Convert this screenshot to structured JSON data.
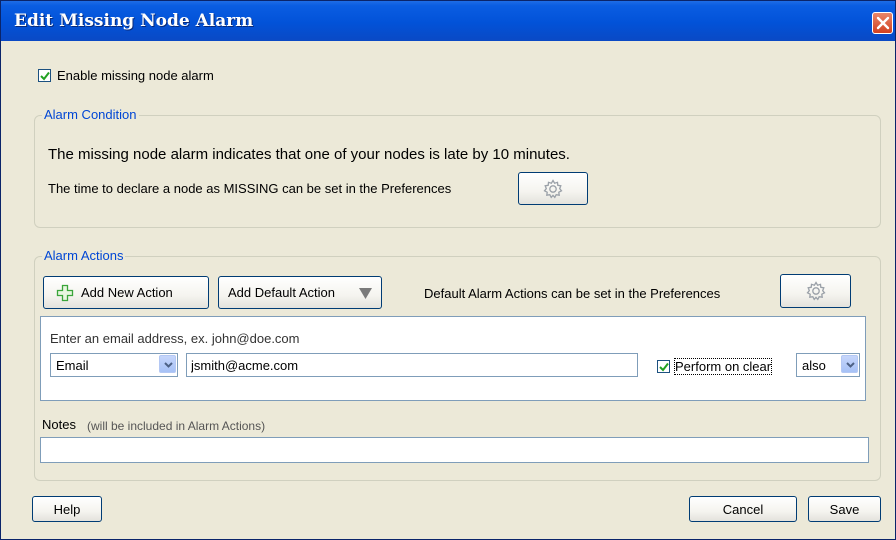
{
  "window": {
    "title": "Edit Missing Node Alarm"
  },
  "enable": {
    "label": "Enable missing node alarm",
    "checked": true
  },
  "condition": {
    "title": "Alarm Condition",
    "description": "The missing node alarm indicates that one of your nodes is late by 10 minutes.",
    "preferences_text": "The time to declare a node as MISSING can be set in the Preferences",
    "preferences_icon": "gear-icon"
  },
  "actions": {
    "title": "Alarm Actions",
    "add_new_label": "Add New Action",
    "add_new_icon": "plus-icon",
    "add_default_label": "Add Default Action",
    "default_text": "Default Alarm Actions can be set in the Preferences",
    "preferences_icon": "gear-icon",
    "row": {
      "hint": "Enter an email address, ex. john@doe.com",
      "type_value": "Email",
      "email_value": "jsmith@acme.com",
      "perform_on_clear_label": "Perform on clear",
      "perform_on_clear_checked": true,
      "also_value": "also"
    }
  },
  "notes": {
    "label": "Notes",
    "hint": "(will be included in Alarm Actions)",
    "value": ""
  },
  "footer": {
    "help_label": "Help",
    "cancel_label": "Cancel",
    "save_label": "Save"
  },
  "colors": {
    "titlebar": "#0a5de2",
    "group_title": "#0046d5",
    "dialog_bg": "#ece9d8",
    "check_green": "#21a121"
  }
}
